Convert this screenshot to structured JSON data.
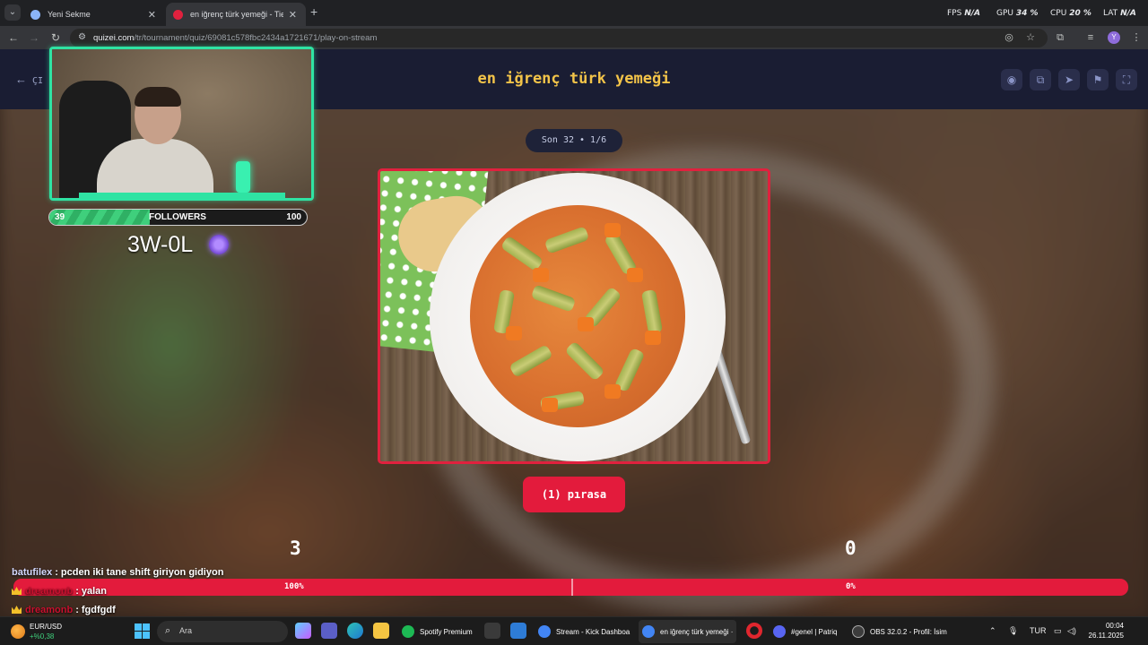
{
  "browser": {
    "tab_menu_glyph": "⌄",
    "tabs": [
      {
        "label": "Yeni Sekme",
        "close": "✕",
        "icon_color": "#8ab4f8"
      },
      {
        "label": "en iğrenç türk yemeği - Tier Lis",
        "close": "✕",
        "icon_color": "#e0213e"
      }
    ],
    "new_tab": "+",
    "perf": [
      {
        "label": "FPS",
        "value": "N/A"
      },
      {
        "label": "GPU",
        "value": "34 %"
      },
      {
        "label": "CPU",
        "value": "20 %"
      },
      {
        "label": "LAT",
        "value": "N/A"
      }
    ],
    "url_host": "quizei.com",
    "url_path": "/tr/tournament/quiz/69081c578fbc2434a1721671/play-on-stream",
    "profile_initial": "Y"
  },
  "quiz": {
    "back_label": "ÇI",
    "title": "en iğrenç türk yemeği",
    "round_label": "Son 32 • 1/6",
    "answer_label": "(1) pırasa",
    "vote_left": "3",
    "vote_right": "0",
    "pct_left": "100%",
    "pct_right": "0%",
    "vote_fraction_left": 0.5,
    "accent": "#e31b3c",
    "title_color": "#f3c449"
  },
  "overlay": {
    "followers_current": "39",
    "followers_label": "FOLLOWERS",
    "followers_goal": "100",
    "followers_fraction": 0.39,
    "score": "3W-0L",
    "accent": "#2fe3a3"
  },
  "chat": [
    {
      "user": "batufilex",
      "sep": " : ",
      "message": "pcden iki tane shift giriyon gidiyon",
      "crown": false,
      "color": "#d3d9ff"
    },
    {
      "user": "dreamonb",
      "sep": " : ",
      "message": "yalan",
      "crown": true,
      "color": "#c8102e"
    },
    {
      "user": "dreamonb",
      "sep": " : ",
      "message": "fgdfgdf",
      "crown": true,
      "color": "#c8102e"
    }
  ],
  "taskbar": {
    "weather_label": "EUR/USD",
    "weather_value": "+%0,38",
    "search_placeholder": "Ara",
    "tasks": [
      {
        "label": "Spotify Premium",
        "color": "#1db954"
      },
      {
        "label": "Stream - Kick Dashboa",
        "color": "#4285f4"
      },
      {
        "label": "en iğrenç türk yemeği ·",
        "color": "#4285f4"
      },
      {
        "label": "#genel | Patriq",
        "color": "#5865f2"
      },
      {
        "label": "OBS 32.0.2 - Profil: İsim",
        "color": "#3c3c3c"
      }
    ],
    "lang": "TUR",
    "time": "00:04",
    "date": "26.11.2025"
  }
}
